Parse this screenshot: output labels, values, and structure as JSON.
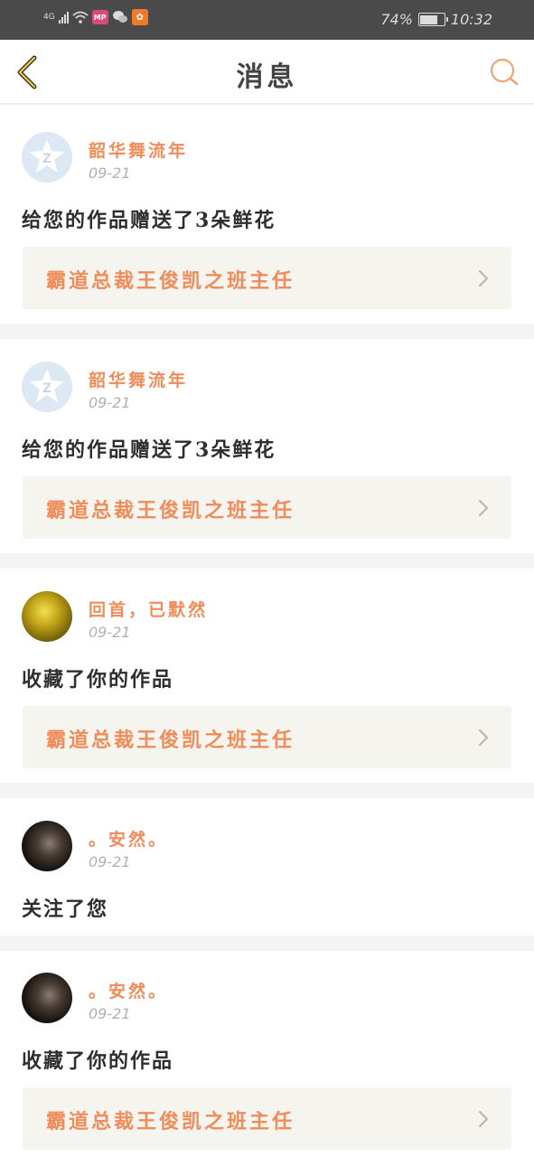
{
  "status_bar": {
    "network": "4G",
    "app_icons": [
      "MP",
      "微信",
      "QQ空间"
    ],
    "battery": "74%",
    "battery_level": 0.74,
    "time": "10:32"
  },
  "header": {
    "title": "消息",
    "back_icon": "chevron-left-icon",
    "search_icon": "search-icon",
    "accent": "#f0a472"
  },
  "messages": [
    {
      "user": "韶华舞流年",
      "date": "09-21",
      "action": "给您的作品赠送了3朵鲜花",
      "work": "霸道总裁王俊凯之班主任",
      "avatar": "qq-avatar-icon"
    },
    {
      "user": "韶华舞流年",
      "date": "09-21",
      "action": "给您的作品赠送了3朵鲜花",
      "work": "霸道总裁王俊凯之班主任",
      "avatar": "qq-avatar-icon"
    },
    {
      "user": "回首，已默然",
      "date": "09-21",
      "action": "收藏了你的作品",
      "work": "霸道总裁王俊凯之班主任",
      "avatar": "gold-avatar"
    },
    {
      "user": "。安然。",
      "date": "09-21",
      "action": "关注了您",
      "avatar": "dark-avatar"
    },
    {
      "user": "。安然。",
      "date": "09-21",
      "action": "收藏了你的作品",
      "work": "霸道总裁王俊凯之班主任",
      "avatar": "dark-avatar"
    }
  ],
  "colors": {
    "username": "#ef8c5a",
    "date": "#b0b0b0",
    "card_bg": "#f5f4ee",
    "separator": "#f5f4f2",
    "status_bar_bg": "#4a4a4a"
  }
}
